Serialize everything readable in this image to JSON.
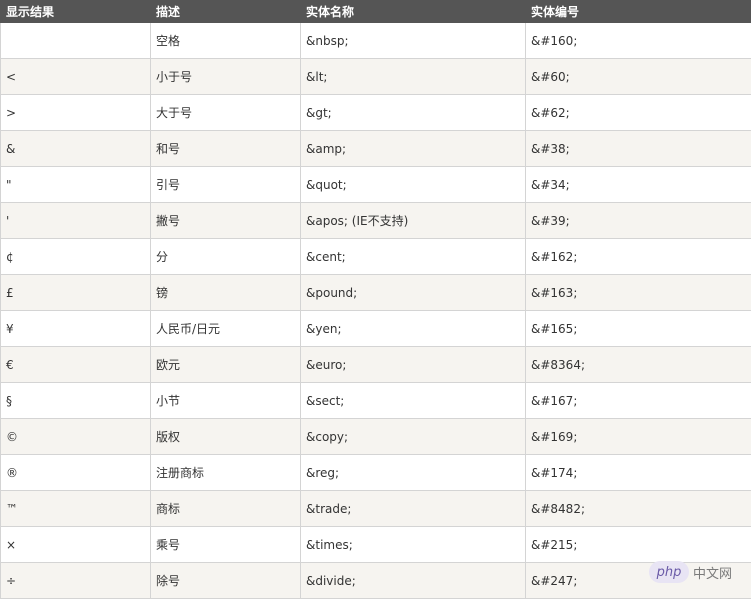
{
  "headers": [
    "显示结果",
    "描述",
    "实体名称",
    "实体编号"
  ],
  "rows": [
    [
      "",
      "空格",
      "&nbsp;",
      "&#160;"
    ],
    [
      "<",
      "小于号",
      "&lt;",
      "&#60;"
    ],
    [
      ">",
      "大于号",
      "&gt;",
      "&#62;"
    ],
    [
      "&",
      "和号",
      "&amp;",
      "&#38;"
    ],
    [
      "\"",
      "引号",
      "&quot;",
      "&#34;"
    ],
    [
      "'",
      "撇号",
      "&apos; (IE不支持)",
      "&#39;"
    ],
    [
      "¢",
      "分",
      "&cent;",
      "&#162;"
    ],
    [
      "£",
      "镑",
      "&pound;",
      "&#163;"
    ],
    [
      "¥",
      "人民币/日元",
      "&yen;",
      "&#165;"
    ],
    [
      "€",
      "欧元",
      "&euro;",
      "&#8364;"
    ],
    [
      "§",
      "小节",
      "&sect;",
      "&#167;"
    ],
    [
      "©",
      "版权",
      "&copy;",
      "&#169;"
    ],
    [
      "®",
      "注册商标",
      "&reg;",
      "&#174;"
    ],
    [
      "™",
      "商标",
      "&trade;",
      "&#8482;"
    ],
    [
      "×",
      "乘号",
      "&times;",
      "&#215;"
    ],
    [
      "÷",
      "除号",
      "&divide;",
      "&#247;"
    ]
  ],
  "watermark": {
    "logo": "php",
    "text": "中文网"
  }
}
